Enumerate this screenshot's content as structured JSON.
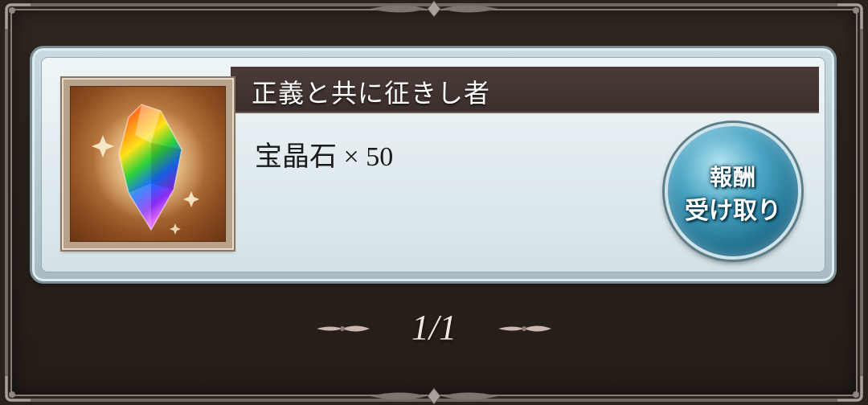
{
  "reward": {
    "title": "正義と共に征きし者",
    "item_name": "宝晶石",
    "multiplier": "×",
    "quantity": "50",
    "item_icon": "rainbow-crystal-icon"
  },
  "claim_button": {
    "line1": "報酬",
    "line2": "受け取り"
  },
  "pagination": {
    "text": "1/1"
  },
  "colors": {
    "title_bar": "#3b2e2b",
    "card": "#dfeaee",
    "button": "#1f6f8f",
    "frame": "#2a211b"
  }
}
